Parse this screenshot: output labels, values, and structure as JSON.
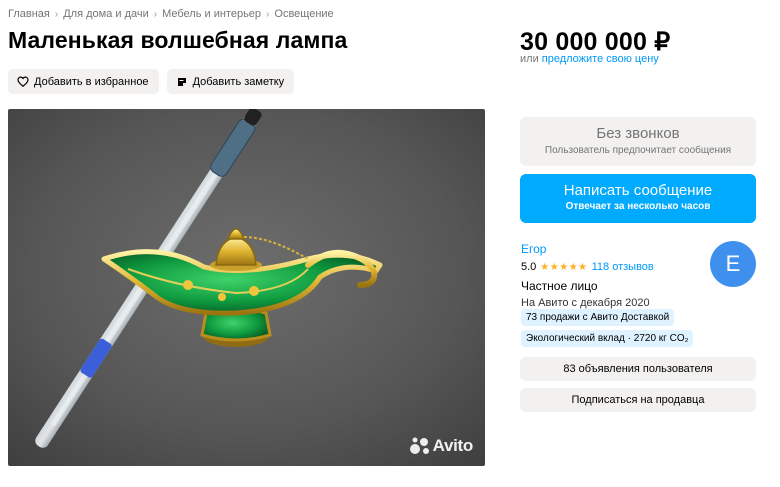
{
  "breadcrumbs": [
    "Главная",
    "Для дома и дачи",
    "Мебель и интерьер",
    "Освещение"
  ],
  "listing": {
    "title": "Маленькая волшебная лампа",
    "favorite_label": "Добавить в избранное",
    "note_label": "Добавить заметку",
    "watermark": "Avito"
  },
  "price": {
    "value": "30 000 000 ₽",
    "or_text": "или ",
    "offer_link": "предложите свою цену"
  },
  "contact": {
    "no_calls_title": "Без звонков",
    "no_calls_sub": "Пользователь предпочитает сообщения",
    "write_title": "Написать сообщение",
    "write_sub": "Отвечает за несколько часов"
  },
  "seller": {
    "name": "Егор",
    "rating": "5.0",
    "stars": "★★★★★",
    "reviews": "118 отзывов",
    "type": "Частное лицо",
    "since": "На Авито с декабря 2020",
    "avatar_letter": "E",
    "badges": [
      "73 продажи с Авито Доставкой",
      "Экологический вклад · 2720 кг CO₂"
    ],
    "ads_button": "83 объявления пользователя",
    "subscribe_button": "Подписаться на продавца"
  },
  "colors": {
    "accent": "#00aaff",
    "link": "#0099f7",
    "star": "#ffb021",
    "button_gray": "#f2f1f0",
    "badge_bg": "#dff2ff",
    "avatar": "#3f8fef"
  },
  "icons": {
    "favorite": "heart-outline-icon",
    "note": "note-icon",
    "chevron": "chevron-right-icon"
  }
}
